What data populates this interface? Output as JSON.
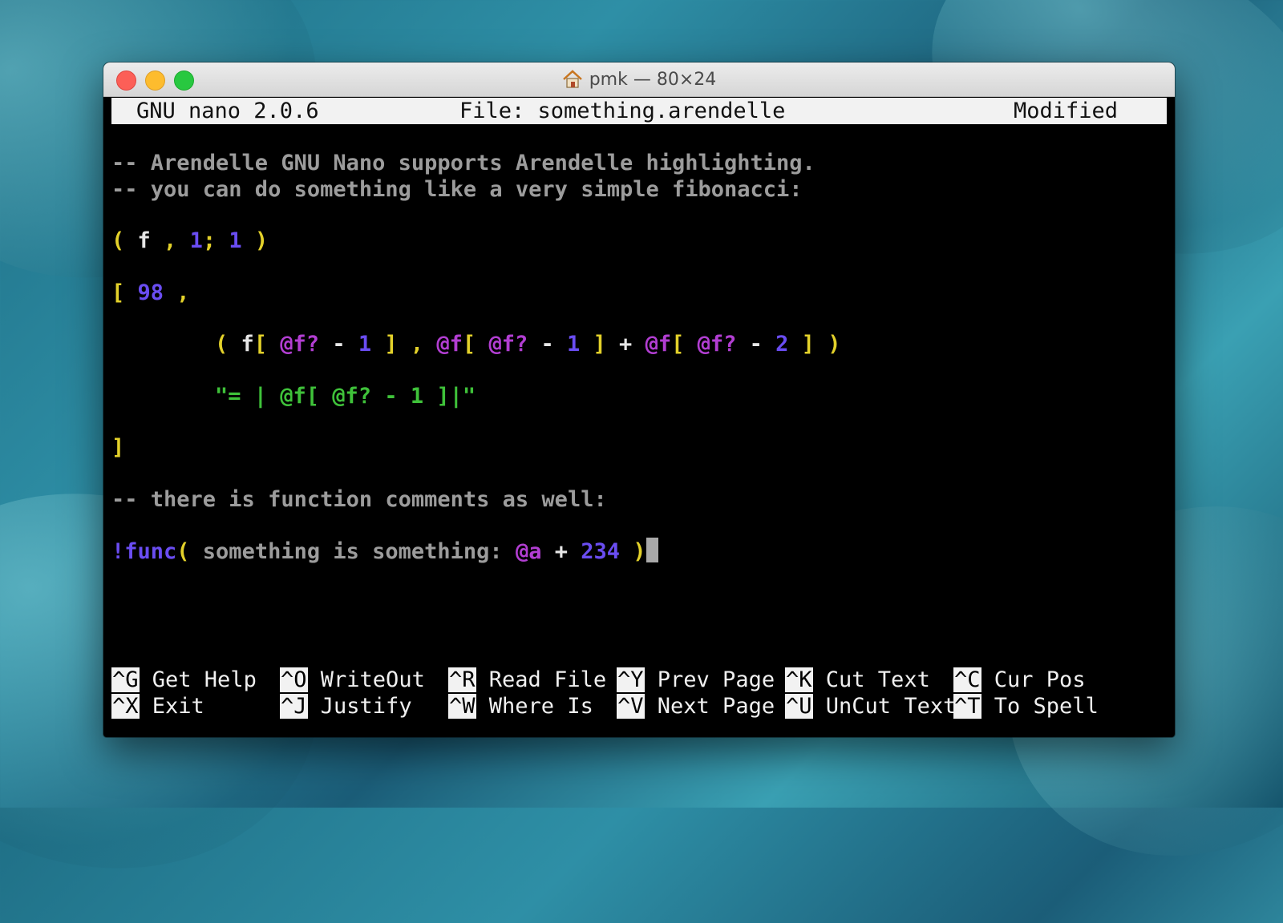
{
  "window": {
    "title": "pmk — 80×24"
  },
  "nano": {
    "version": "GNU nano 2.0.6",
    "file": "File: something.arendelle",
    "status": "Modified"
  },
  "code": {
    "comment1": "-- Arendelle GNU Nano supports Arendelle highlighting.",
    "comment2": "-- you can do something like a very simple fibonacci:",
    "line3": {
      "open": "( ",
      "name": "f",
      "comma": " , ",
      "n1": "1",
      "semi": "; ",
      "n2": "1",
      "close": " )"
    },
    "line4": {
      "bracket": "[ ",
      "num": "98",
      "comma": " ,"
    },
    "line5": {
      "p1": "( ",
      "f": "f",
      "b1": "[ ",
      "at1": "@f?",
      "minus1": " - ",
      "one1": "1",
      "b2": " ] , ",
      "at2": "@f",
      "b3": "[ ",
      "at3": "@f?",
      "minus2": " - ",
      "one2": "1",
      "b4": " ] ",
      "plus": "+ ",
      "at4": "@f",
      "b5": "[ ",
      "at5": "@f?",
      "minus3": " - ",
      "two": "2",
      "b6": " ] )"
    },
    "line6": "\"= | @f[ @f? - 1 ]|\"",
    "line7": "]",
    "comment3": "-- there is function comments as well:",
    "line8": {
      "bang": "!func",
      "paren": "( ",
      "text": "something is something: ",
      "at": "@a",
      "plus": " + ",
      "num": "234",
      "close": " )"
    }
  },
  "shortcuts": [
    {
      "key": "^G",
      "label": "Get Help"
    },
    {
      "key": "^O",
      "label": "WriteOut"
    },
    {
      "key": "^R",
      "label": "Read File"
    },
    {
      "key": "^Y",
      "label": "Prev Page"
    },
    {
      "key": "^K",
      "label": "Cut Text"
    },
    {
      "key": "^C",
      "label": "Cur Pos"
    },
    {
      "key": "^X",
      "label": "Exit"
    },
    {
      "key": "^J",
      "label": "Justify"
    },
    {
      "key": "^W",
      "label": "Where Is"
    },
    {
      "key": "^V",
      "label": "Next Page"
    },
    {
      "key": "^U",
      "label": "UnCut Text"
    },
    {
      "key": "^T",
      "label": "To Spell"
    }
  ]
}
